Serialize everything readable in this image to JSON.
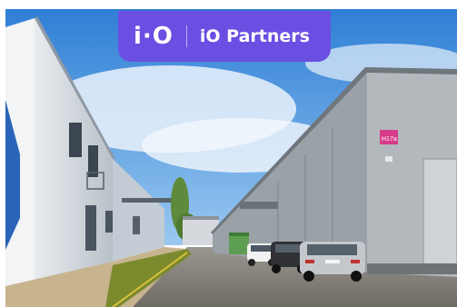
{
  "brand": {
    "logo_mark": "i·O",
    "name": "iO Partners",
    "accent_color": "#6b4fe2"
  },
  "scene": {
    "unit_sign": "H17a"
  }
}
